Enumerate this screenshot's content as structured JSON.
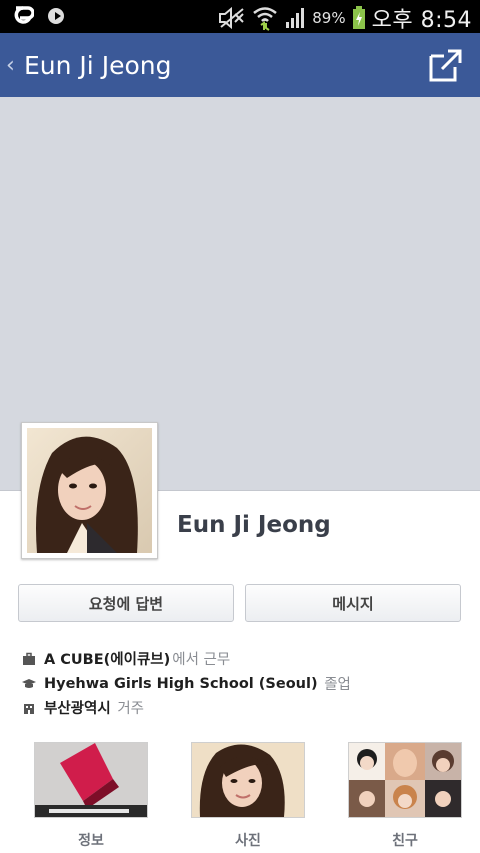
{
  "status_bar": {
    "battery_percent": "89%",
    "clock": "오후 8:54",
    "icons": [
      "g-app-icon",
      "music-icon",
      "mute-icon",
      "wifi-icon",
      "signal-icon",
      "battery-charging-icon"
    ]
  },
  "app_bar": {
    "back_icon": "chevron-left-icon",
    "title": "Eun Ji Jeong",
    "share_icon": "share-external-icon",
    "color": "#3b5998"
  },
  "profile": {
    "name": "Eun Ji Jeong"
  },
  "actions": {
    "respond_label": "요청에 답변",
    "message_label": "메시지"
  },
  "info": {
    "work": {
      "place": "A CUBE(에이큐브)",
      "suffix": "에서 근무",
      "icon": "briefcase-icon"
    },
    "school": {
      "place": "Hyehwa Girls High School (Seoul)",
      "suffix": "졸업",
      "icon": "graduation-cap-icon"
    },
    "home": {
      "place": "부산광역시",
      "suffix": "거주",
      "icon": "house-icon"
    }
  },
  "thumbnails": {
    "info_label": "정보",
    "photos_label": "사진",
    "friends_label": "친구"
  }
}
